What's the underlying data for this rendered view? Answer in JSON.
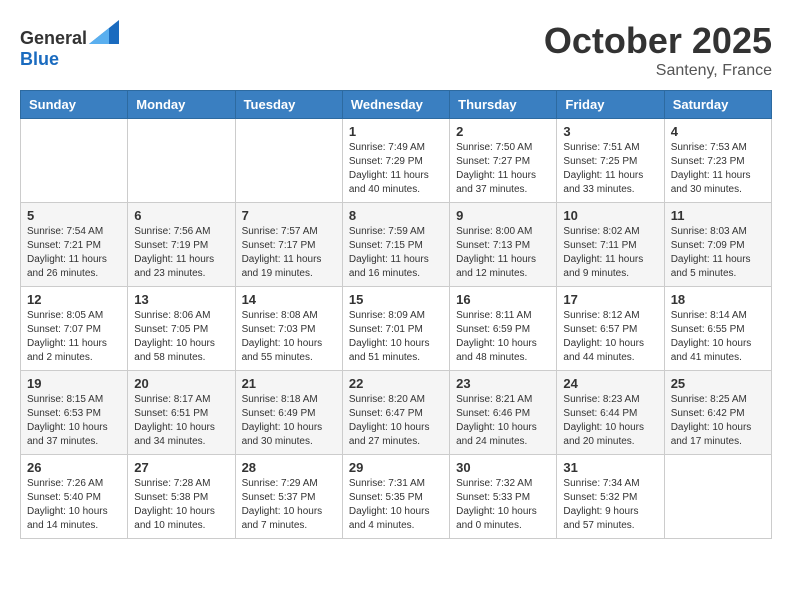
{
  "header": {
    "logo_general": "General",
    "logo_blue": "Blue",
    "month": "October 2025",
    "location": "Santeny, France"
  },
  "weekdays": [
    "Sunday",
    "Monday",
    "Tuesday",
    "Wednesday",
    "Thursday",
    "Friday",
    "Saturday"
  ],
  "weeks": [
    [
      {
        "day": "",
        "info": ""
      },
      {
        "day": "",
        "info": ""
      },
      {
        "day": "",
        "info": ""
      },
      {
        "day": "1",
        "info": "Sunrise: 7:49 AM\nSunset: 7:29 PM\nDaylight: 11 hours\nand 40 minutes."
      },
      {
        "day": "2",
        "info": "Sunrise: 7:50 AM\nSunset: 7:27 PM\nDaylight: 11 hours\nand 37 minutes."
      },
      {
        "day": "3",
        "info": "Sunrise: 7:51 AM\nSunset: 7:25 PM\nDaylight: 11 hours\nand 33 minutes."
      },
      {
        "day": "4",
        "info": "Sunrise: 7:53 AM\nSunset: 7:23 PM\nDaylight: 11 hours\nand 30 minutes."
      }
    ],
    [
      {
        "day": "5",
        "info": "Sunrise: 7:54 AM\nSunset: 7:21 PM\nDaylight: 11 hours\nand 26 minutes."
      },
      {
        "day": "6",
        "info": "Sunrise: 7:56 AM\nSunset: 7:19 PM\nDaylight: 11 hours\nand 23 minutes."
      },
      {
        "day": "7",
        "info": "Sunrise: 7:57 AM\nSunset: 7:17 PM\nDaylight: 11 hours\nand 19 minutes."
      },
      {
        "day": "8",
        "info": "Sunrise: 7:59 AM\nSunset: 7:15 PM\nDaylight: 11 hours\nand 16 minutes."
      },
      {
        "day": "9",
        "info": "Sunrise: 8:00 AM\nSunset: 7:13 PM\nDaylight: 11 hours\nand 12 minutes."
      },
      {
        "day": "10",
        "info": "Sunrise: 8:02 AM\nSunset: 7:11 PM\nDaylight: 11 hours\nand 9 minutes."
      },
      {
        "day": "11",
        "info": "Sunrise: 8:03 AM\nSunset: 7:09 PM\nDaylight: 11 hours\nand 5 minutes."
      }
    ],
    [
      {
        "day": "12",
        "info": "Sunrise: 8:05 AM\nSunset: 7:07 PM\nDaylight: 11 hours\nand 2 minutes."
      },
      {
        "day": "13",
        "info": "Sunrise: 8:06 AM\nSunset: 7:05 PM\nDaylight: 10 hours\nand 58 minutes."
      },
      {
        "day": "14",
        "info": "Sunrise: 8:08 AM\nSunset: 7:03 PM\nDaylight: 10 hours\nand 55 minutes."
      },
      {
        "day": "15",
        "info": "Sunrise: 8:09 AM\nSunset: 7:01 PM\nDaylight: 10 hours\nand 51 minutes."
      },
      {
        "day": "16",
        "info": "Sunrise: 8:11 AM\nSunset: 6:59 PM\nDaylight: 10 hours\nand 48 minutes."
      },
      {
        "day": "17",
        "info": "Sunrise: 8:12 AM\nSunset: 6:57 PM\nDaylight: 10 hours\nand 44 minutes."
      },
      {
        "day": "18",
        "info": "Sunrise: 8:14 AM\nSunset: 6:55 PM\nDaylight: 10 hours\nand 41 minutes."
      }
    ],
    [
      {
        "day": "19",
        "info": "Sunrise: 8:15 AM\nSunset: 6:53 PM\nDaylight: 10 hours\nand 37 minutes."
      },
      {
        "day": "20",
        "info": "Sunrise: 8:17 AM\nSunset: 6:51 PM\nDaylight: 10 hours\nand 34 minutes."
      },
      {
        "day": "21",
        "info": "Sunrise: 8:18 AM\nSunset: 6:49 PM\nDaylight: 10 hours\nand 30 minutes."
      },
      {
        "day": "22",
        "info": "Sunrise: 8:20 AM\nSunset: 6:47 PM\nDaylight: 10 hours\nand 27 minutes."
      },
      {
        "day": "23",
        "info": "Sunrise: 8:21 AM\nSunset: 6:46 PM\nDaylight: 10 hours\nand 24 minutes."
      },
      {
        "day": "24",
        "info": "Sunrise: 8:23 AM\nSunset: 6:44 PM\nDaylight: 10 hours\nand 20 minutes."
      },
      {
        "day": "25",
        "info": "Sunrise: 8:25 AM\nSunset: 6:42 PM\nDaylight: 10 hours\nand 17 minutes."
      }
    ],
    [
      {
        "day": "26",
        "info": "Sunrise: 7:26 AM\nSunset: 5:40 PM\nDaylight: 10 hours\nand 14 minutes."
      },
      {
        "day": "27",
        "info": "Sunrise: 7:28 AM\nSunset: 5:38 PM\nDaylight: 10 hours\nand 10 minutes."
      },
      {
        "day": "28",
        "info": "Sunrise: 7:29 AM\nSunset: 5:37 PM\nDaylight: 10 hours\nand 7 minutes."
      },
      {
        "day": "29",
        "info": "Sunrise: 7:31 AM\nSunset: 5:35 PM\nDaylight: 10 hours\nand 4 minutes."
      },
      {
        "day": "30",
        "info": "Sunrise: 7:32 AM\nSunset: 5:33 PM\nDaylight: 10 hours\nand 0 minutes."
      },
      {
        "day": "31",
        "info": "Sunrise: 7:34 AM\nSunset: 5:32 PM\nDaylight: 9 hours\nand 57 minutes."
      },
      {
        "day": "",
        "info": ""
      }
    ]
  ]
}
